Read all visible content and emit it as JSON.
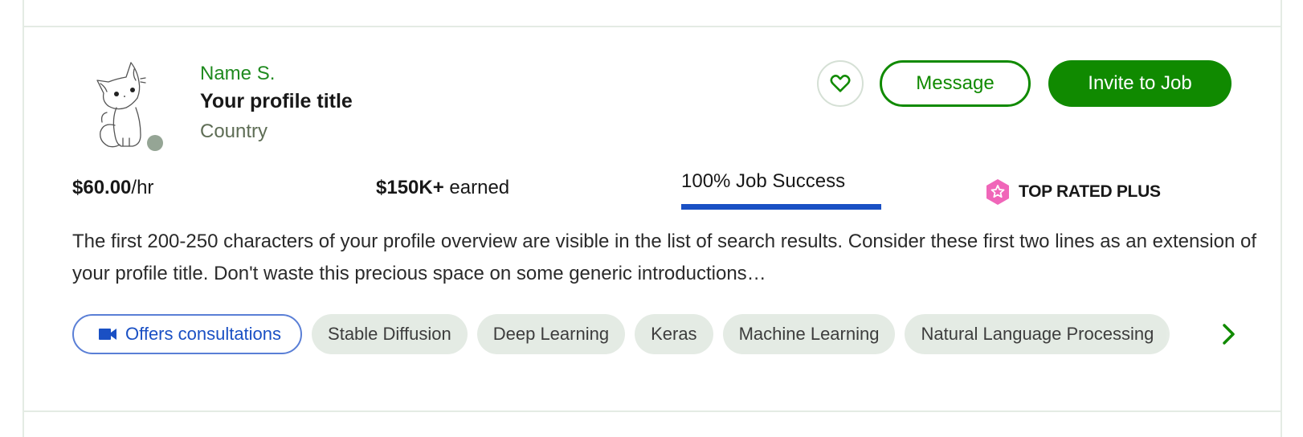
{
  "freelancer": {
    "name": "Name S.",
    "profile_title": "Your profile title",
    "country": "Country",
    "avatar_icon": "cat-illustration",
    "online_status": "offline"
  },
  "actions": {
    "save_icon": "heart-icon",
    "message_label": "Message",
    "invite_label": "Invite to Job"
  },
  "stats": {
    "rate_value": "$60.00",
    "rate_unit": "/hr",
    "earned_value": "$150K+",
    "earned_label": "earned",
    "job_success_label": "100% Job Success",
    "job_success_percent": 100,
    "badge_icon": "top-rated-plus-badge-icon",
    "badge_label": "TOP RATED PLUS"
  },
  "overview": "The first 200-250 characters of your profile overview are visible in the list of search results. Consider these first two lines as an extension of your profile title. Don't waste this precious space on some generic introductions…",
  "skills": {
    "consultation_label": "Offers consultations",
    "consultation_icon": "video-camera-icon",
    "items": [
      "Stable Diffusion",
      "Deep Learning",
      "Keras",
      "Machine Learning",
      "Natural Language Processing"
    ],
    "next_icon": "chevron-right-icon"
  },
  "colors": {
    "brand_green": "#108a00",
    "link_green": "#1f8a1f",
    "job_success_blue": "#1a50c4",
    "badge_pink": "#f066b9",
    "chip_bg": "#e4ebe4",
    "divider": "#e4ebe4"
  }
}
